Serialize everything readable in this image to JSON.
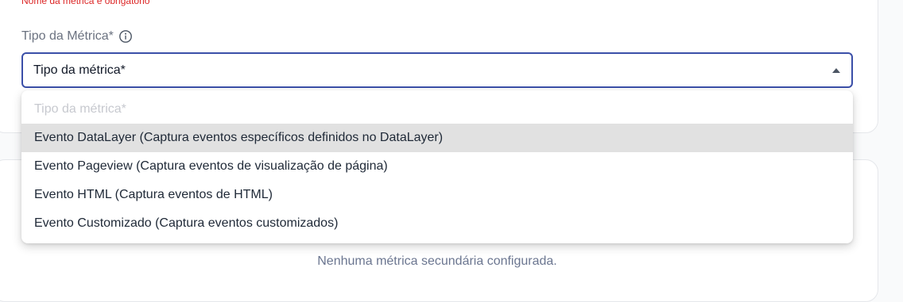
{
  "form": {
    "error_message": "Nome da métrica é obrigatório",
    "metric_type_label": "Tipo da Métrica*",
    "info_icon": "info-circle-icon",
    "select": {
      "value": "Tipo da métrica*",
      "caret_icon": "caret-up-icon"
    }
  },
  "dropdown": {
    "placeholder": "Tipo da métrica*",
    "options": [
      {
        "label": "Evento DataLayer (Captura eventos específicos definidos no DataLayer)",
        "highlighted": true
      },
      {
        "label": "Evento Pageview (Captura eventos de visualização de página)",
        "highlighted": false
      },
      {
        "label": "Evento HTML (Captura eventos de HTML)",
        "highlighted": false
      },
      {
        "label": "Evento Customizado (Captura eventos customizados)",
        "highlighted": false
      }
    ]
  },
  "secondary_metrics": {
    "empty_message": "Nenhuma métrica secundária configurada."
  },
  "colors": {
    "error": "#dc2626",
    "focus_border": "#3b4fa8",
    "highlight_bg": "#e1e1e1"
  }
}
